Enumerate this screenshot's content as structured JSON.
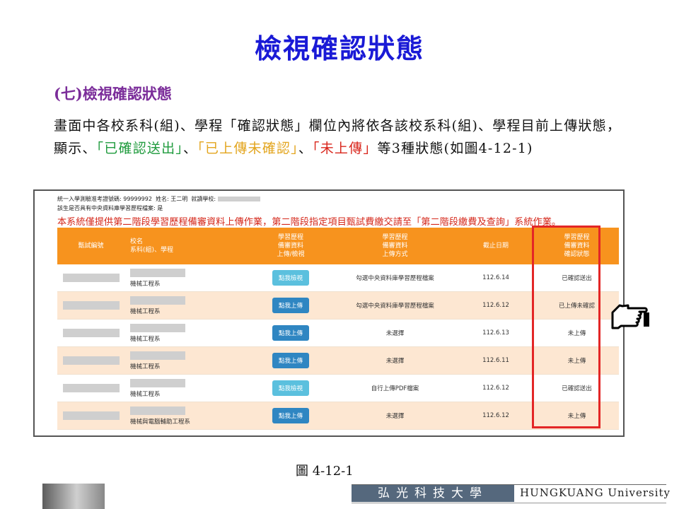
{
  "slide": {
    "title": "檢視確認狀態",
    "section_heading": "(七)檢視確認狀態",
    "paragraph": {
      "part1": "畫面中各校系科(組)、學程「確認狀態」欄位內將依各該校系科(組)、學程目前上傳狀態，顯示、",
      "status_confirmed": "「已確認送出」",
      "sep1": "、",
      "status_uploaded": "「已上傳未確認」",
      "sep2": "、",
      "status_not_uploaded": "「未上傳」",
      "part2": "等3種狀態(如圖4-12-1)"
    },
    "caption": "圖 4-12-1",
    "colors": {
      "title": "#1a1ad6",
      "heading": "#7b2d9a",
      "green": "#1f9b3d",
      "yellow": "#e3a51e",
      "red": "#d9261c",
      "table_header": "#f7931e",
      "highlight_box": "#e32626"
    },
    "pointer_icon": "pointing-hand-icon"
  },
  "screenshot": {
    "exam_no_label": "統一入學測驗准考證號碼: 99999992",
    "name_label": "姓名: 王二明",
    "school_label": "就讀學校:",
    "central_db_label": "該生是否具有中央資料庫學習歷程檔案: 是",
    "notice": "本系統僅提供第二階段學習歷程備審資料上傳作業，第二階段指定項目甄試費繳交請至「第二階段繳費及查詢」系統作業。",
    "headers": {
      "id": "甄試編號",
      "school_line1": "校名",
      "school_line2": "系科(組)、學程",
      "upload_line1": "學習歷程",
      "upload_line2": "備審資料",
      "upload_line3": "上傳/檢視",
      "method_line1": "學習歷程",
      "method_line2": "備審資料",
      "method_line3": "上傳方式",
      "deadline": "截止日期",
      "status_line1": "學習歷程",
      "status_line2": "備審資料",
      "status_line3": "確認狀態"
    },
    "rows": [
      {
        "dept": "機械工程系",
        "button": "點我檢視",
        "method": "勾選中央資料庫學習歷程檔案",
        "deadline": "112.6.14",
        "status": "已確認送出"
      },
      {
        "dept": "機械工程系",
        "button": "點我上傳",
        "method": "勾選中央資料庫學習歷程檔案",
        "deadline": "112.6.12",
        "status": "已上傳未確認"
      },
      {
        "dept": "機械工程系",
        "button": "點我上傳",
        "method": "未選擇",
        "deadline": "112.6.13",
        "status": "未上傳"
      },
      {
        "dept": "機械工程系",
        "button": "點我上傳",
        "method": "未選擇",
        "deadline": "112.6.11",
        "status": "未上傳"
      },
      {
        "dept": "機械工程系",
        "button": "點我檢視",
        "method": "自行上傳PDF檔案",
        "deadline": "112.6.12",
        "status": "已確認送出"
      },
      {
        "dept": "機械與電腦輔助工程系",
        "button": "點我上傳",
        "method": "未選擇",
        "deadline": "112.6.12",
        "status": "未上傳"
      }
    ]
  },
  "footer": {
    "university_cn": "弘光科技大學",
    "university_en": "HUNGKUANG University"
  }
}
